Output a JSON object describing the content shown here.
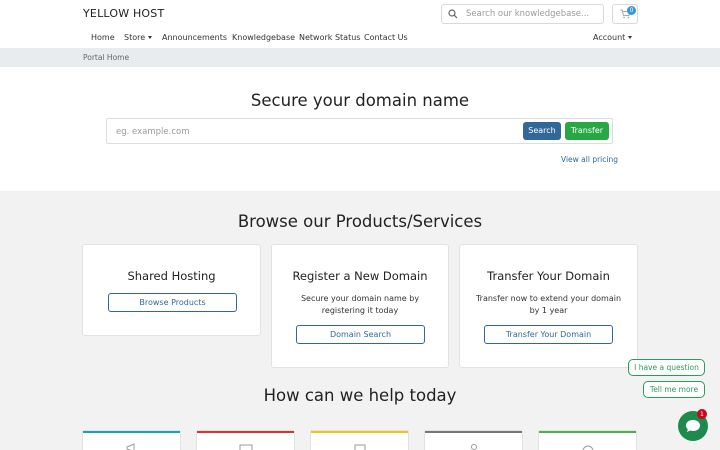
{
  "brand": "YELLOW HOST",
  "search": {
    "placeholder": "Search our knowledgebase..."
  },
  "cart": {
    "count": "0"
  },
  "nav": {
    "home": "Home",
    "store": "Store",
    "announcements": "Announcements",
    "knowledgebase": "Knowledgebase",
    "network_status": "Network Status",
    "contact_us": "Contact Us",
    "account": "Account"
  },
  "breadcrumb": "Portal Home",
  "hero": {
    "title": "Secure your domain name",
    "domain_placeholder": "eg. example.com",
    "search_label": "Search",
    "transfer_label": "Transfer",
    "pricing_link": "View all pricing"
  },
  "products": {
    "title": "Browse our Products/Services",
    "cards": [
      {
        "title": "Shared Hosting",
        "text": "",
        "button": "Browse Products"
      },
      {
        "title": "Register a New Domain",
        "text": "Secure your domain name by registering it today",
        "button": "Domain Search"
      },
      {
        "title": "Transfer Your Domain",
        "text": "Transfer now to extend your domain by 1 year",
        "button": "Transfer Your Domain"
      }
    ]
  },
  "help": {
    "title": "How can we help today",
    "cards": [
      {
        "icon": "megaphone-icon",
        "color": "#17a2b8"
      },
      {
        "icon": "server-icon",
        "color": "#d9342b"
      },
      {
        "icon": "book-icon",
        "color": "#f0c419"
      },
      {
        "icon": "user-icon",
        "color": "#777777"
      },
      {
        "icon": "ticket-icon",
        "color": "#4caf50"
      }
    ]
  },
  "chat": {
    "question_label": "I have a question",
    "more_label": "Tell me more",
    "badge": "1"
  },
  "colors": {
    "primary": "#336699",
    "success": "#28a745",
    "chat": "#1e8a4c",
    "badge": "#d0021b"
  }
}
